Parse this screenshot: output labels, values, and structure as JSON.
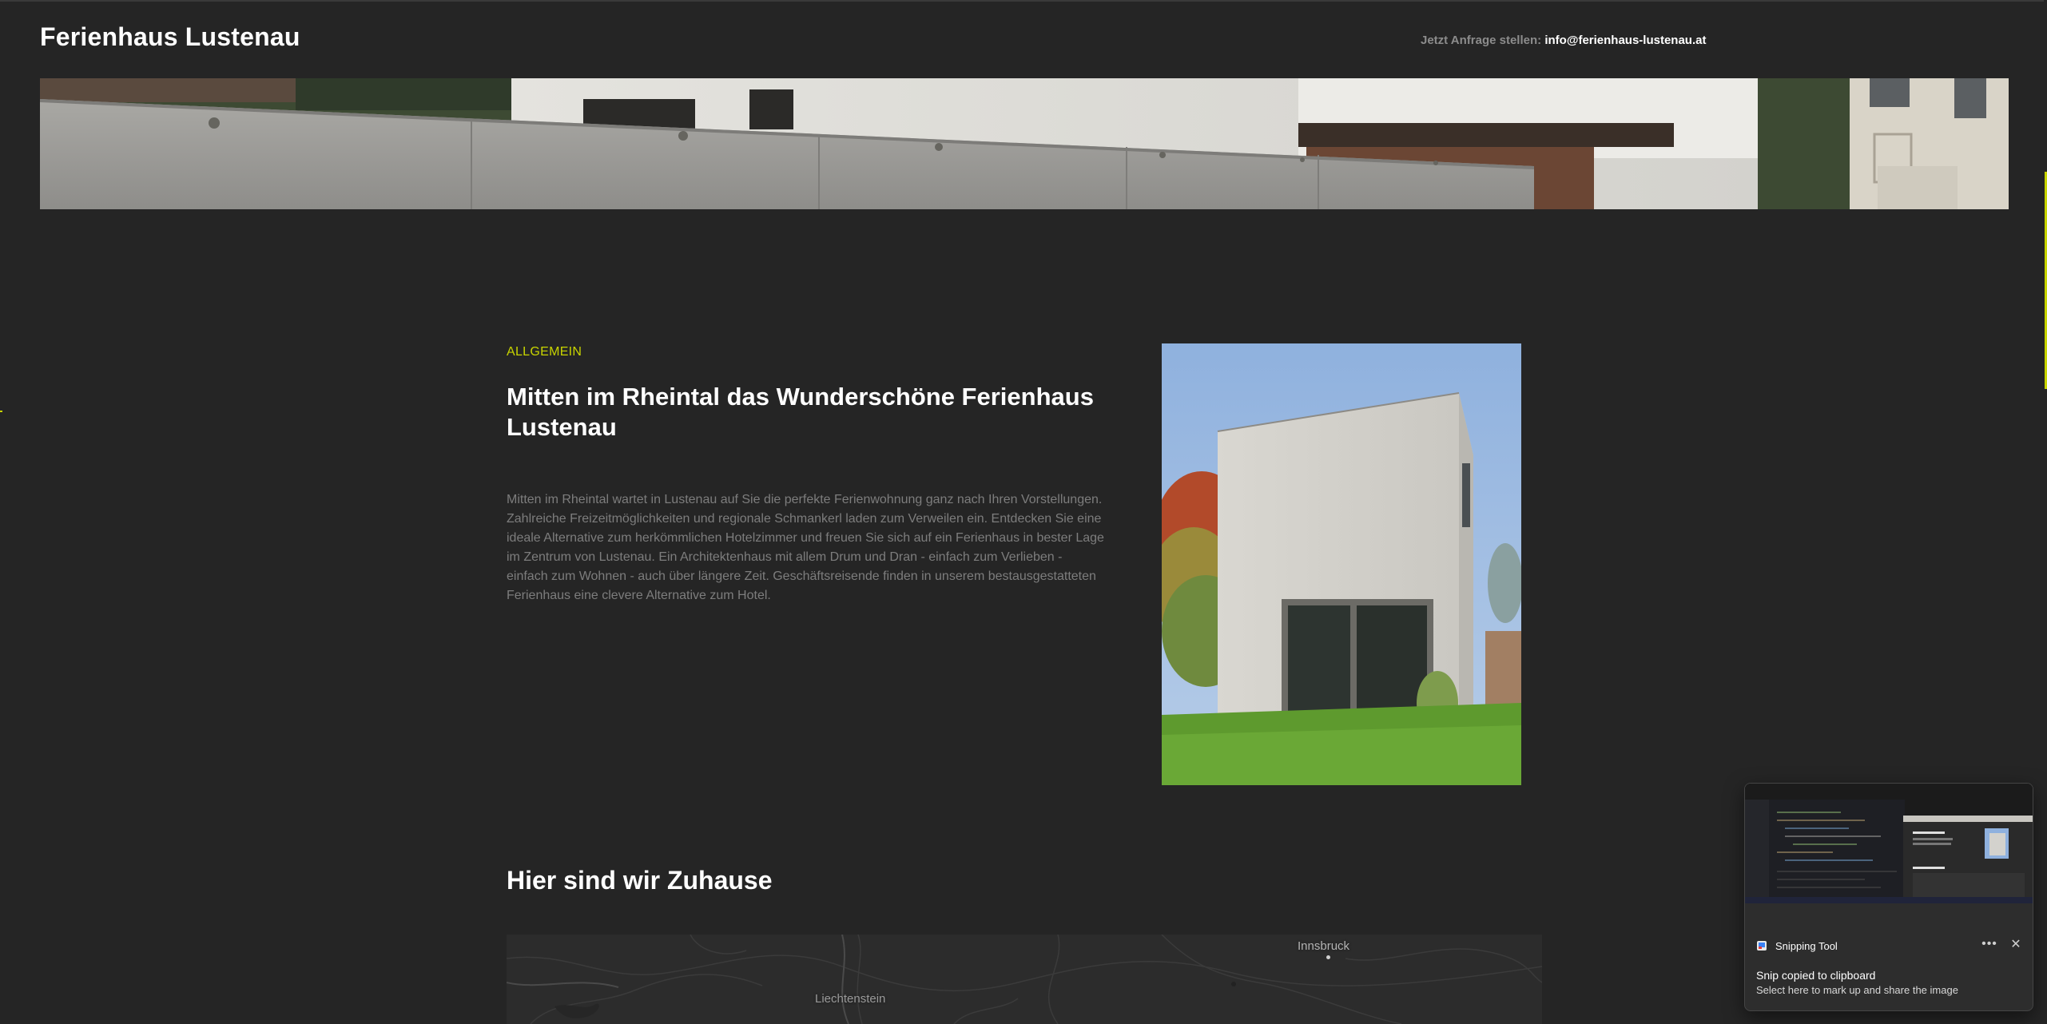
{
  "header": {
    "site_title": "Ferienhaus Lustenau",
    "contact_label": "Jetzt Anfrage stellen:",
    "contact_email": "info@ferienhaus-lustenau.at"
  },
  "intro": {
    "kicker": "ALLGEMEIN",
    "title": "Mitten im Rheintal das Wunderschöne Ferienhaus Lustenau",
    "text": "Mitten im Rheintal wartet in Lustenau auf Sie die perfekte Ferienwohnung ganz nach Ihren Vorstellungen. Zahlreiche Freizeitmöglichkeiten und regionale Schmankerl laden zum Verweilen ein. Entdecken Sie eine ideale Alternative zum herkömmlichen Hotelzimmer und freuen Sie sich auf ein Ferienhaus in bester Lage im Zentrum von Lustenau. Ein Architektenhaus mit allem Drum und Dran - einfach zum Verlieben - einfach zum Wohnen - auch über längere Zeit. Geschäftsreisende finden in unserem bestausgestatteten Ferienhaus eine clevere Alternative zum Hotel."
  },
  "location": {
    "title": "Hier sind wir Zuhause",
    "map_labels": {
      "innsbruck": "Innsbruck",
      "liechtenstein": "Liechtenstein"
    }
  },
  "toast": {
    "app_name": "Snipping Tool",
    "more_icon": "more-icon",
    "close_icon": "close-icon",
    "title": "Snip copied to clipboard",
    "body": "Select here to mark up and share the image"
  },
  "colors": {
    "background": "#252525",
    "accent": "#c8d400",
    "muted_text": "#7d7d7d"
  }
}
